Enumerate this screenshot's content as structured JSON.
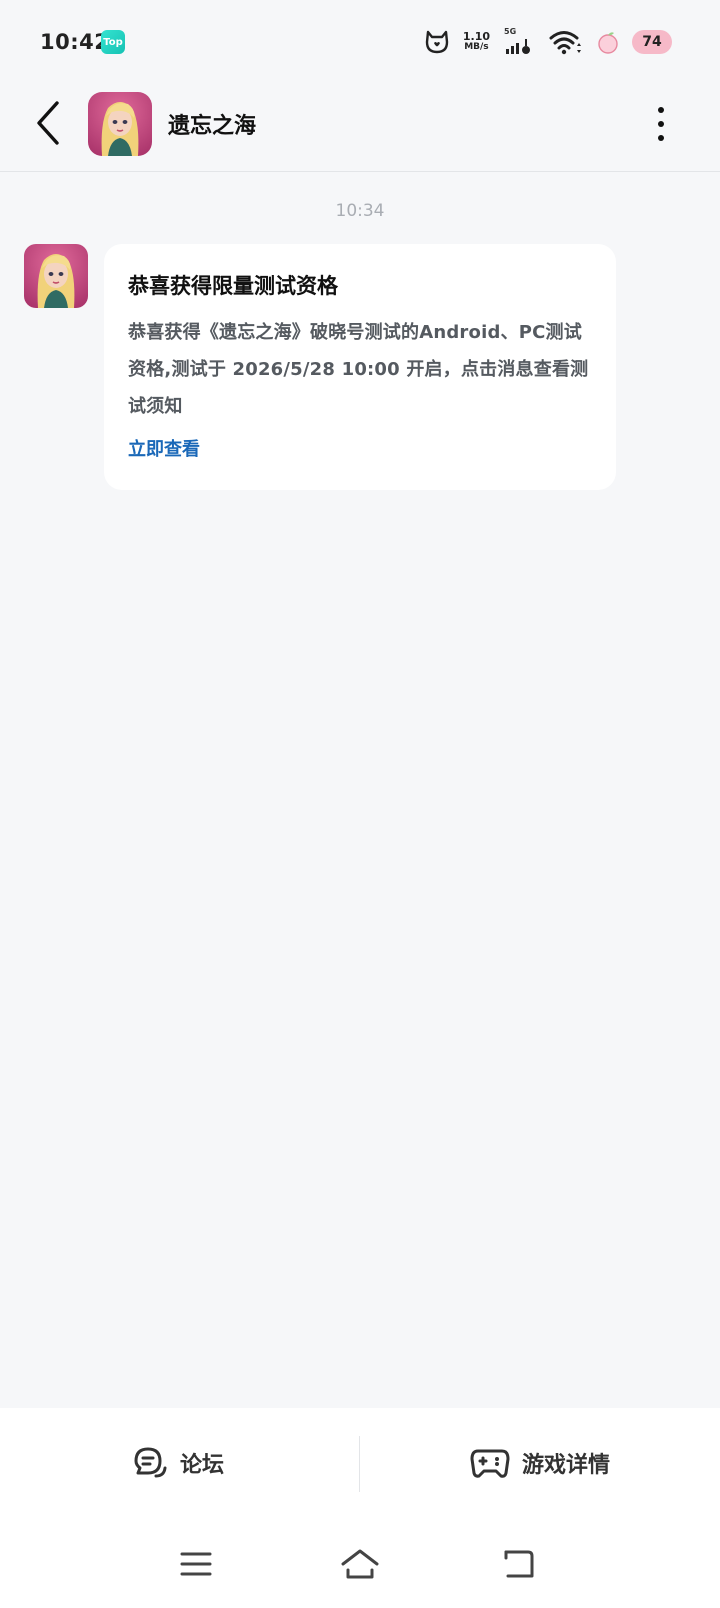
{
  "status_bar": {
    "time": "10:42",
    "app_badge": "Top",
    "net_speed_value": "1.10",
    "net_speed_unit": "MB/s",
    "network_type": "5G",
    "battery": "74"
  },
  "header": {
    "title": "遗忘之海"
  },
  "chat": {
    "timestamp": "10:34",
    "message": {
      "title": "恭喜获得限量测试资格",
      "body": "恭喜获得《遗忘之海》破晓号测试的Android、PC测试资格,测试于 2026/5/28  10:00 开启，点击消息查看测试须知",
      "link": "立即查看"
    }
  },
  "bottom_bar": {
    "forum_label": "论坛",
    "details_label": "游戏详情"
  },
  "colors": {
    "background": "#f6f7f9",
    "link": "#1a68b8",
    "app_badge": "#16c2b4",
    "battery_badge": "#f6b9c8"
  },
  "icons": [
    "back-icon",
    "more-icon",
    "forum-icon",
    "gamepad-icon",
    "menu-icon",
    "home-icon",
    "return-icon"
  ]
}
